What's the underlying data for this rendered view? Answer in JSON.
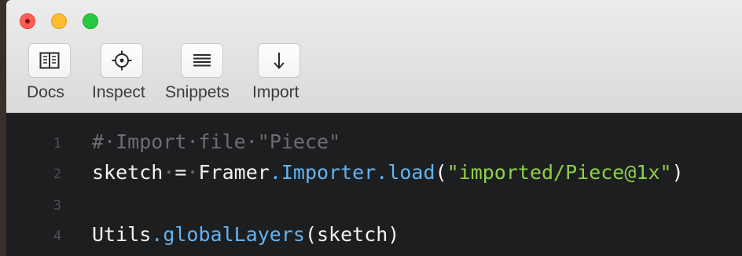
{
  "toolbar": {
    "docs_label": "Docs",
    "inspect_label": "Inspect",
    "snippets_label": "Snippets",
    "import_label": "Import",
    "icons": {
      "docs": "book-icon",
      "inspect": "crosshair-icon",
      "snippets": "lines-icon",
      "import": "arrow-down-icon"
    }
  },
  "editor": {
    "line_numbers": [
      "1",
      "2",
      "3",
      "4"
    ],
    "lines": [
      {
        "tokens": [
          {
            "text": "#",
            "kind": "comment"
          },
          {
            "text": "·",
            "kind": "dot"
          },
          {
            "text": "Import",
            "kind": "comment"
          },
          {
            "text": "·",
            "kind": "dot"
          },
          {
            "text": "file",
            "kind": "comment"
          },
          {
            "text": "·",
            "kind": "dot"
          },
          {
            "text": "\"Piece\"",
            "kind": "comment"
          }
        ]
      },
      {
        "tokens": [
          {
            "text": "sketch",
            "kind": "default"
          },
          {
            "text": "·",
            "kind": "dot"
          },
          {
            "text": "=",
            "kind": "default"
          },
          {
            "text": "·",
            "kind": "dot"
          },
          {
            "text": "Framer",
            "kind": "default"
          },
          {
            "text": ".Importer.load",
            "kind": "member"
          },
          {
            "text": "(",
            "kind": "default"
          },
          {
            "text": "\"imported/Piece@1x\"",
            "kind": "string"
          },
          {
            "text": ")",
            "kind": "default"
          }
        ]
      },
      {
        "tokens": []
      },
      {
        "tokens": [
          {
            "text": "Utils",
            "kind": "default"
          },
          {
            "text": ".globalLayers",
            "kind": "member"
          },
          {
            "text": "(sketch)",
            "kind": "default"
          }
        ]
      }
    ]
  },
  "colors": {
    "editor_bg": "#1d1e20",
    "comment": "#6b6d71",
    "member": "#63b3f1",
    "string": "#8ed04a",
    "close": "#fd5f57",
    "minimize": "#febc2e",
    "zoom": "#28c840"
  }
}
